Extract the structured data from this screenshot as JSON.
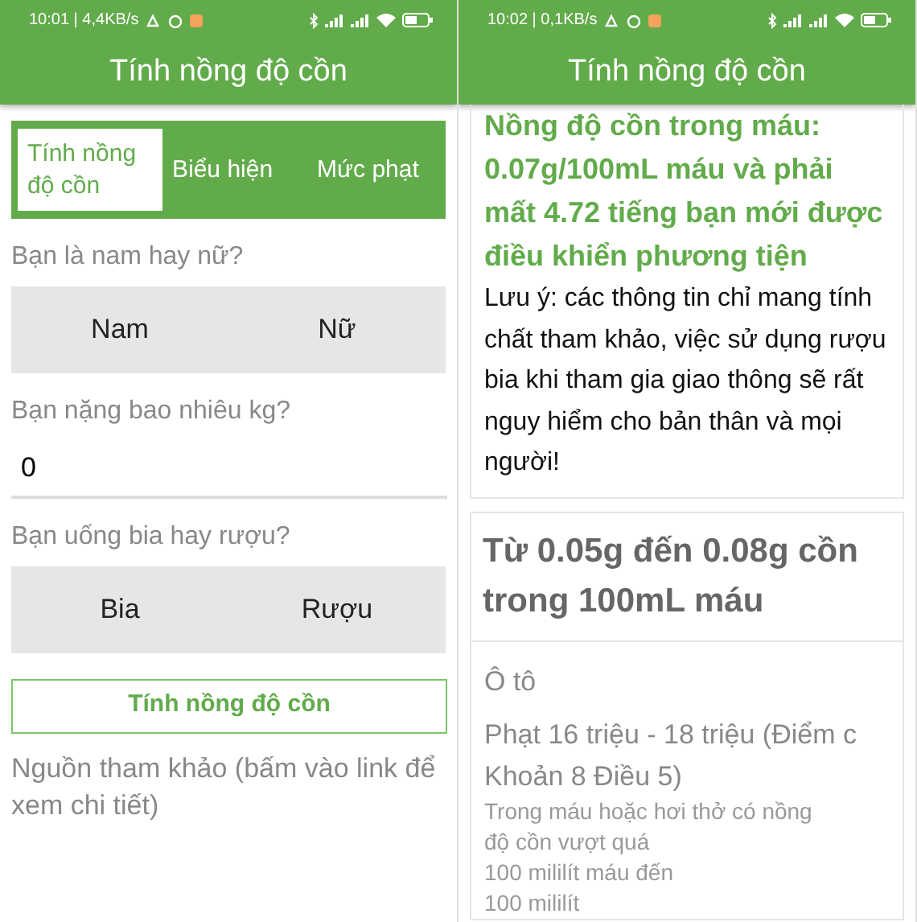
{
  "screens": [
    {
      "status_bar": {
        "time": "10:01 | 4,4KB/s"
      },
      "app_bar": {
        "title": "Tính nồng độ cồn"
      },
      "tabs": [
        {
          "label": "Tính nồng độ cồn",
          "selected": true
        },
        {
          "label": "Biểu hiện",
          "selected": false
        },
        {
          "label": "Mức phạt",
          "selected": false
        }
      ],
      "form": [
        {
          "kind": "choice",
          "label": "Bạn là nam hay nữ?",
          "options": [
            {
              "label": "Nam",
              "selected": false
            },
            {
              "label": "Nữ",
              "selected": false
            }
          ]
        },
        {
          "kind": "input",
          "label": "Bạn nặng bao nhiêu kg?",
          "value": "0"
        },
        {
          "kind": "choice",
          "label": "Bạn uống bia hay rượu?",
          "options": [
            {
              "label": "Bia",
              "selected": false
            },
            {
              "label": "Rượu",
              "selected": false
            }
          ]
        }
      ],
      "submit_button": "Tính nồng độ cồn",
      "source_note": "Nguồn tham khảo (bấm vào link để xem chi tiết)"
    },
    {
      "status_bar": {
        "time": "10:02 | 0,1KB/s"
      },
      "app_bar": {
        "title": "Tính nồng độ cồn"
      },
      "result_card": {
        "result": "Nồng độ cồn trong máu: 0.07g/100mL máu và phải mất 4.72 tiếng bạn mới được điều khiển phương tiện",
        "note": "Lưu ý: các thông tin chỉ mang tính chất tham khảo, việc sử dụng rượu bia khi tham gia giao thông sẽ rất nguy hiểm cho bản thân và mọi người!"
      },
      "penalty_card": {
        "heading": "Từ 0.05g đến 0.08g cồn trong 100mL máu",
        "vehicle": "Ô tô",
        "penalty": "Phạt 16 triệu - 18 triệu (Điểm c Khoản 8 Điều 5)",
        "detail_lines": [
          "Trong máu hoặc hơi thở có nồng",
          "độ cồn vượt quá",
          "100 mililít máu đến",
          "100 mililít"
        ]
      }
    }
  ]
}
